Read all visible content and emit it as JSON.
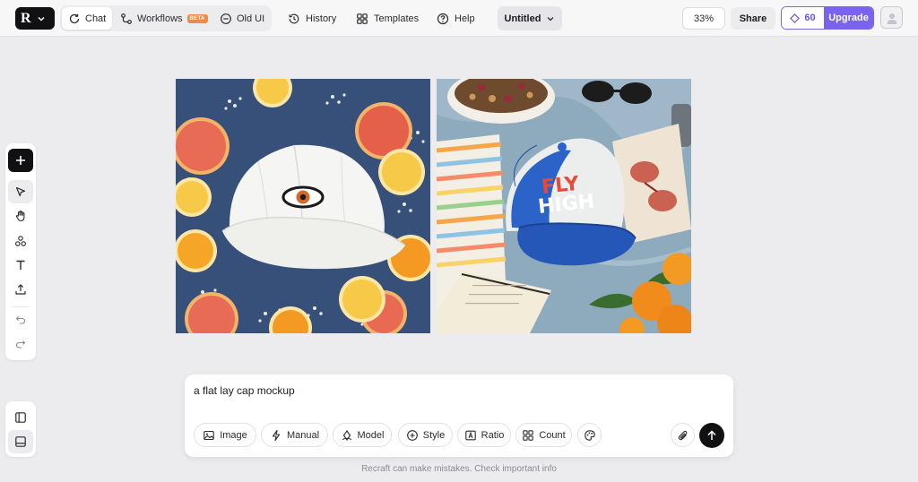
{
  "app": {
    "logo_letter": "R"
  },
  "header": {
    "modes": [
      {
        "label": "Chat",
        "icon": "chat-refresh-icon"
      },
      {
        "label": "Workflows",
        "icon": "workflows-icon",
        "badge": "BETA"
      },
      {
        "label": "Old UI",
        "icon": "old-ui-icon"
      }
    ],
    "history": "History",
    "templates": "Templates",
    "help": "Help",
    "document_title": "Untitled",
    "zoom": "33%",
    "share": "Share",
    "credits": "60",
    "upgrade": "Upgrade"
  },
  "tools": [
    {
      "name": "add",
      "icon": "plus-icon"
    },
    {
      "name": "select",
      "icon": "cursor-icon"
    },
    {
      "name": "hand",
      "icon": "hand-icon"
    },
    {
      "name": "shapes",
      "icon": "shapes-icon"
    },
    {
      "name": "text",
      "icon": "text-icon"
    },
    {
      "name": "upload",
      "icon": "upload-icon"
    },
    {
      "name": "undo",
      "icon": "undo-icon"
    },
    {
      "name": "redo",
      "icon": "redo-icon"
    }
  ],
  "canvas": {
    "images": [
      {
        "description_icon": "white-cap-image",
        "text_on_cap": ""
      },
      {
        "description_icon": "blue-cap-image",
        "text_on_cap": "FLY HIGH"
      }
    ]
  },
  "prompt": {
    "text": "a flat lay cap mockup",
    "chips": [
      "Image",
      "Manual",
      "Model",
      "Style",
      "Ratio",
      "Count"
    ]
  },
  "disclaimer": "Recraft can make mistakes. Check important info",
  "colors": {
    "accent": "#7a63ee",
    "beta_badge": "#f08a4b",
    "background": "#ececee"
  }
}
